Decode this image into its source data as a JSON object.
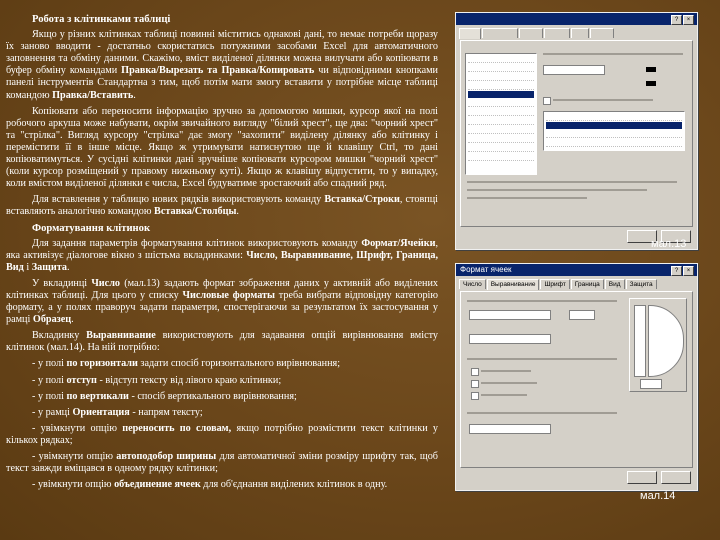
{
  "title": "Робота з клітинками таблиці",
  "p1": "Якщо у різних клітинках таблиці повинні міститись однакові дані, то немає потреби щоразу їх заново вводити - достатньо скористатись потужними засобами Excel для автоматичного заповнення та обміну даними. Скажімо, вміст виділеної ділянки можна вилучати або копіювати в буфер обміну командами ",
  "p1_b1": "Правка/Вырезать та Правка/Копировать",
  "p1_rest": " чи відповідними кнопками панелі інструментів Стандартна з тим, щоб потім мати змогу вставити у потрібне місце таблиці командою ",
  "p1_b2": "Правка/Вставить",
  "p1_end": ".",
  "p2": "Копіювати або переносити інформацію зручно за допомогою мишки, курсор якої на полі робочого аркуша може набувати, окрім звичайного вигляду \"білий хрест\", ще два: \"чорний хрест\" та \"стрілка\". Вигляд курсору \"стрілка\" дає змогу \"захопити\" виділену ділянку або клітинку і перемістити її в інше місце. Якщо ж утримувати натиснутою ще й клавішу Ctrl, то дані копіюватимуться. У сусідні клітинки дані зручніше копіювати курсором мишки \"чорний хрест\" (коли курсор розміщений у правому нижньому куті). Якщо ж клавішу відпустити, то у випадку, коли вмістом виділеної ділянки є числа, Excel будуватиме зростаючий або спадний ряд.",
  "p3_a": "Для вставлення у таблицю нових рядків використовують команду ",
  "p3_b1": "Вставка/Строки",
  "p3_mid": ", стовпці вставляють аналогічно командою ",
  "p3_b2": "Вставка/Столбцы",
  "p3_end": ".",
  "subtitle": "Форматування клітинок",
  "p4_a": "Для задання параметрів форматування клітинок використовують команду ",
  "p4_b1": "Формат/Ячейки",
  "p4_mid": ", яка активізує діалогове вікно з шістьма вкладинками: ",
  "p4_b2": "Число, Выравнивание, Шрифт, Граница, Вид",
  "p4_and": " і ",
  "p4_b3": "Защита",
  "p4_end": ".",
  "p5_a": "У вкладинці ",
  "p5_b1": "Число",
  "p5_mid": " (мал.13) задають формат зображення даних у активній або виділених клітинках таблиці. Для цього у списку ",
  "p5_b2": "Числовые форматы",
  "p5_mid2": " треба вибрати відповідну категорію формату, а у полях праворуч задати параметри, спостерігаючи за результатом їх застосування у рамці ",
  "p5_b3": "Образец",
  "p5_end": ".",
  "p6_a": "Вкладинку ",
  "p6_b1": "Выравнивание",
  "p6_rest": " використовують для задавання опцій вирівнювання вмісту клітинок (мал.14). На ній потрібно:",
  "b1_a": "- у полі ",
  "b1_b": "по горизонтали",
  "b1_c": " задати спосіб горизонтального вирівнювання;",
  "b2_a": "- у полі ",
  "b2_b": "отступ",
  "b2_c": " - відступ тексту від лівого краю клітинки;",
  "b3_a": "- у полі ",
  "b3_b": "по вертикали",
  "b3_c": " - спосіб вертикального вирівнювання;",
  "b4_a": "- у рамці ",
  "b4_b": "Ориентация",
  "b4_c": " - напрям тексту;",
  "b5_a": "- увімкнути опцію ",
  "b5_b": "переносить по словам,",
  "b5_c": " якщо потрібно розмістити текст клітинки у кількох рядках;",
  "b6_a": "- увімкнути опцію ",
  "b6_b": "автоподобор ширины",
  "b6_c": " для автоматичної зміни розміру шрифту так, щоб текст завжди вміщався в одному рядку клітинки;",
  "b7_a": "- увімкнути опцію ",
  "b7_b": "объединение ячеек",
  "b7_c": " для об'єднання виділених клітинок в одну.",
  "caption1": "мал.13",
  "caption2": "мал.14",
  "dialog2_title": "Формат ячеек",
  "dialog2_tabs": [
    "Число",
    "Выравнивание",
    "Шрифт",
    "Граница",
    "Вид",
    "Защита"
  ]
}
